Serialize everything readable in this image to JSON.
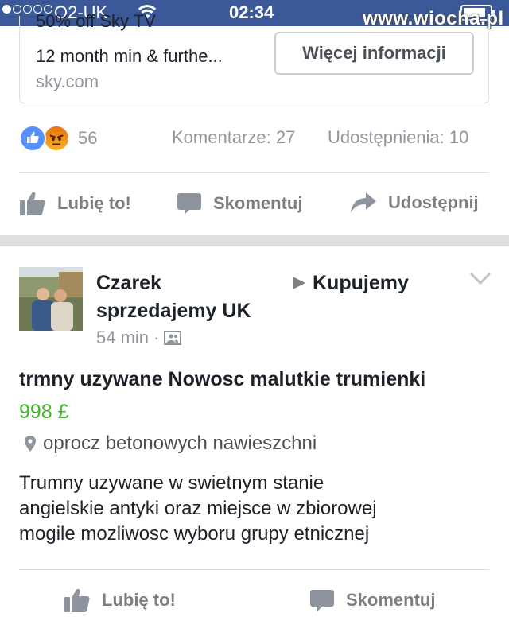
{
  "status_bar": {
    "carrier": "O2-UK",
    "time": "02:34",
    "signal_bars_filled": 1,
    "signal_bars_total": 5,
    "battery_level": 0.85
  },
  "watermark": "www.wiocha.pl",
  "ad": {
    "title": "50% off Sky TV",
    "description": "12 month min & furthe...",
    "domain": "sky.com",
    "button_label": "Więcej informacji"
  },
  "top_post": {
    "reaction_count": "56",
    "comments": "Komentarze: 27",
    "shares": "Udostępnienia: 10",
    "actions": {
      "like": "Lubię to!",
      "comment": "Skomentuj",
      "share": "Udostępnij"
    }
  },
  "sale_post": {
    "author_line1": "Czarek",
    "author_line2": "sprzedajemy UK",
    "group": "Kupujemy",
    "time": "54 min",
    "separator": "·",
    "item_title": "trmny uzywane Nowosc malutkie trumienki",
    "price": "998 £",
    "location": "oprocz betonowych nawieszchni",
    "description_lines": [
      "Trumny uzywane w swietnym stanie",
      "angielskie antyki oraz miejsce w zbiorowej",
      "mogile mozliwosc wyboru grupy etnicznej"
    ],
    "actions": {
      "like": "Lubię to!",
      "comment": "Skomentuj"
    }
  },
  "colors": {
    "facebook_blue": "#3b5998",
    "price_green": "#42b72a",
    "action_gray": "#7f7f7f",
    "meta_gray": "#90949c"
  }
}
